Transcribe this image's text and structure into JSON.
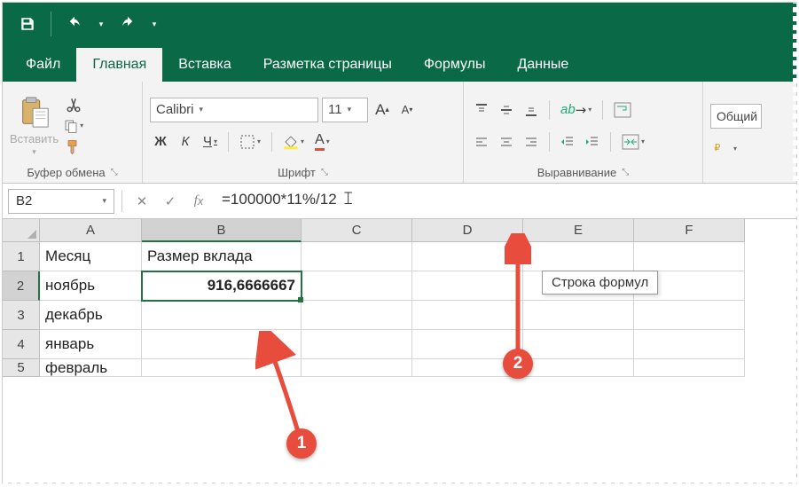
{
  "titlebar": {
    "save_icon": "save-icon",
    "undo_icon": "undo-icon",
    "redo_icon": "redo-icon"
  },
  "tabs": {
    "file": "Файл",
    "home": "Главная",
    "insert": "Вставка",
    "page_layout": "Разметка страницы",
    "formulas": "Формулы",
    "data": "Данные"
  },
  "ribbon": {
    "clipboard": {
      "paste_label": "Вставить",
      "group_label": "Буфер обмена"
    },
    "font": {
      "name": "Calibri",
      "size": "11",
      "bold": "Ж",
      "italic": "К",
      "underline": "Ч",
      "group_label": "Шрифт",
      "inc_a": "A",
      "dec_a": "A"
    },
    "alignment": {
      "group_label": "Выравнивание"
    },
    "number": {
      "format": "Общий"
    }
  },
  "formula_bar": {
    "cell_ref": "B2",
    "formula": "=100000*11%/12",
    "tooltip": "Строка формул"
  },
  "columns": [
    "A",
    "B",
    "C",
    "D",
    "E",
    "F"
  ],
  "rows": [
    {
      "n": "1",
      "A": "Месяц",
      "B": "Размер вклада"
    },
    {
      "n": "2",
      "A": "ноябрь",
      "B": "916,6666667"
    },
    {
      "n": "3",
      "A": "декабрь",
      "B": ""
    },
    {
      "n": "4",
      "A": "январь",
      "B": ""
    },
    {
      "n": "5",
      "A": "февраль",
      "B": ""
    }
  ],
  "callouts": {
    "c1": "1",
    "c2": "2"
  }
}
